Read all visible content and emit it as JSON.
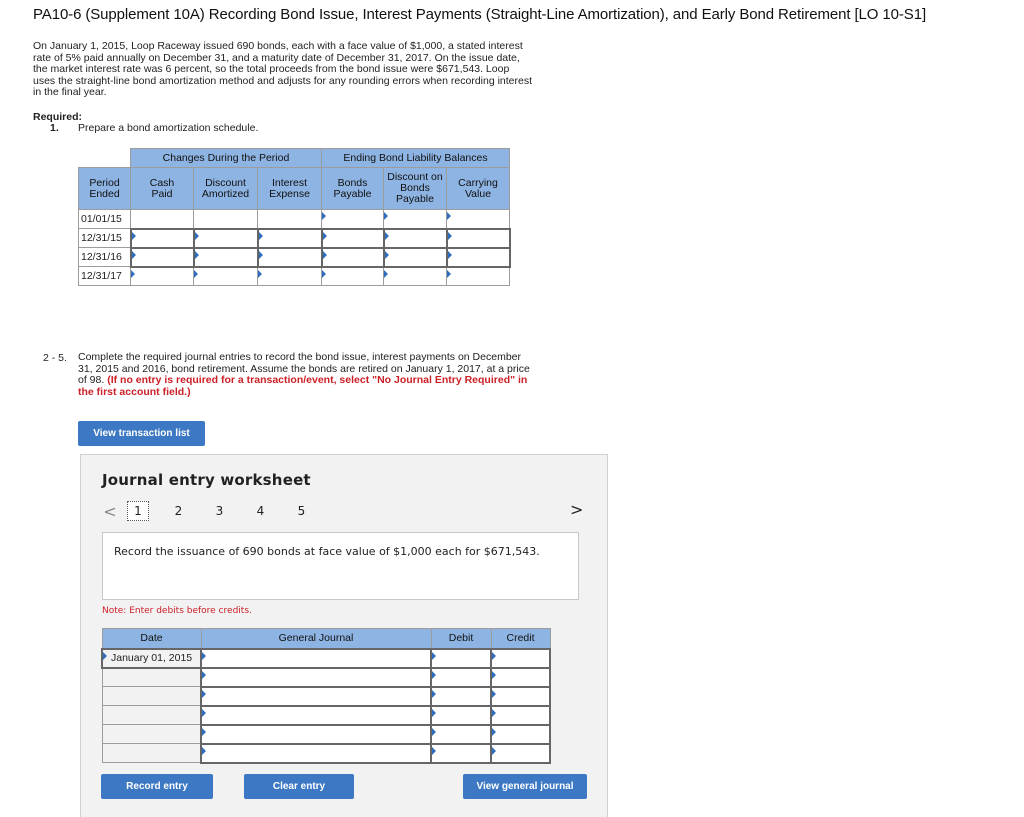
{
  "header": {
    "title": "PA10-6 (Supplement 10A) Recording Bond Issue, Interest Payments (Straight-Line Amortization), and Early Bond Retirement [LO 10-S1]"
  },
  "problem": {
    "text": "On January 1, 2015, Loop Raceway issued 690 bonds, each with a face value of $1,000, a stated interest rate of 5% paid annually on December 31, and a maturity date of December 31, 2017. On the issue date, the market interest rate was 6 percent, so the total proceeds from the bond issue were $671,543. Loop uses the straight-line bond amortization method and adjusts for any rounding errors when recording interest in the final year."
  },
  "required": {
    "label": "Required:",
    "item1_number": "1.",
    "item1_text": "Prepare a bond amortization schedule."
  },
  "amortization_table": {
    "group_headers": {
      "changes": "Changes During the Period",
      "balances": "Ending Bond Liability Balances"
    },
    "columns": {
      "period_ended": "Period Ended",
      "cash_paid": "Cash Paid",
      "discount_amortized": "Discount Amortized",
      "interest_expense": "Interest Expense",
      "bonds_payable": "Bonds Payable",
      "discount_on_bonds_payable": "Discount on Bonds Payable",
      "carrying_value": "Carrying Value"
    },
    "rows": [
      {
        "period": "01/01/15"
      },
      {
        "period": "12/31/15"
      },
      {
        "period": "12/31/16"
      },
      {
        "period": "12/31/17"
      }
    ]
  },
  "part2": {
    "number": "2 - 5.",
    "text": "Complete the required journal entries to record the bond issue, interest payments on December 31, 2015 and 2016, bond retirement. Assume the bonds are retired on January 1, 2017, at a price of 98.",
    "instruction": "(If no entry is required for a transaction/event, select \"No Journal Entry Required\" in the first account field.)"
  },
  "buttons": {
    "view_transaction_list": "View transaction list",
    "record_entry": "Record entry",
    "clear_entry": "Clear entry",
    "view_general_journal": "View general journal"
  },
  "worksheet": {
    "title": "Journal entry worksheet",
    "pages": [
      "1",
      "2",
      "3",
      "4",
      "5"
    ],
    "active_page": "1",
    "prev_icon": "<",
    "next_icon": ">",
    "prompt": "Record the issuance of 690 bonds at face value of $1,000 each for $671,543.",
    "note": "Note: Enter debits before credits.",
    "columns": {
      "date": "Date",
      "general_journal": "General Journal",
      "debit": "Debit",
      "credit": "Credit"
    },
    "rows": [
      {
        "date": "January 01, 2015",
        "account": "",
        "debit": "",
        "credit": ""
      },
      {
        "date": "",
        "account": "",
        "debit": "",
        "credit": ""
      },
      {
        "date": "",
        "account": "",
        "debit": "",
        "credit": ""
      },
      {
        "date": "",
        "account": "",
        "debit": "",
        "credit": ""
      },
      {
        "date": "",
        "account": "",
        "debit": "",
        "credit": ""
      },
      {
        "date": "",
        "account": "",
        "debit": "",
        "credit": ""
      }
    ]
  },
  "colors": {
    "header_blue": "#8eb4e3",
    "button_blue": "#3c78c3",
    "alert_red": "#cc2027",
    "worksheet_bg": "#f2f2f2"
  }
}
